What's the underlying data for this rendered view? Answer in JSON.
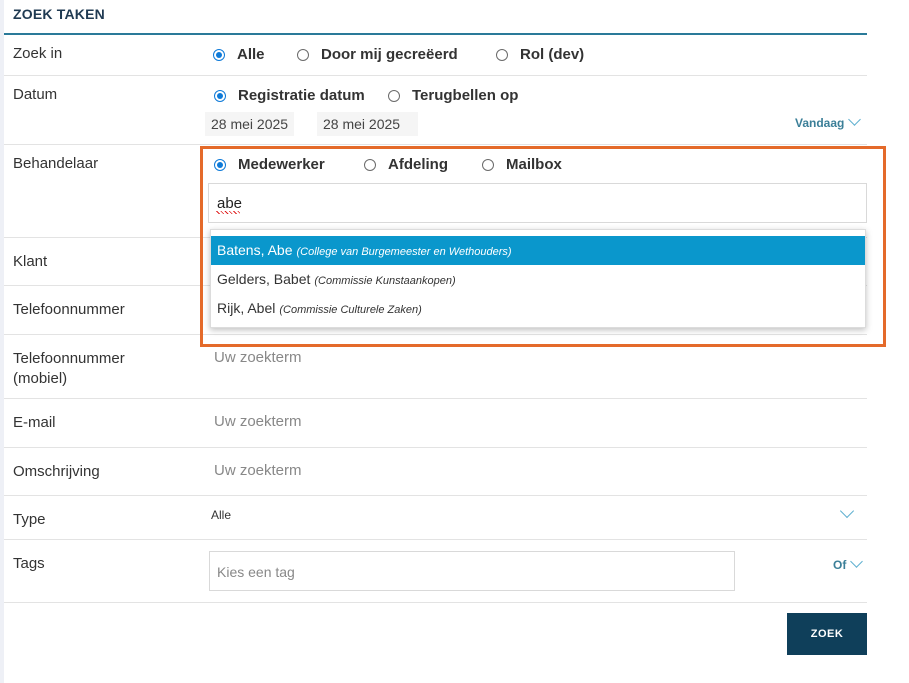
{
  "header": {
    "title": "ZOEK TAKEN"
  },
  "fields": {
    "zoek_in": {
      "label": "Zoek in",
      "options": [
        "Alle",
        "Door mij gecreëerd",
        "Rol (dev)"
      ],
      "selected": "Alle"
    },
    "datum": {
      "label": "Datum",
      "options": [
        "Registratie datum",
        "Terugbellen op"
      ],
      "selected": "Registratie datum",
      "from": "28 mei 2025",
      "to": "28 mei 2025",
      "preset": "Vandaag"
    },
    "behandelaar": {
      "label": "Behandelaar",
      "options": [
        "Medewerker",
        "Afdeling",
        "Mailbox"
      ],
      "selected": "Medewerker",
      "input_value": "abe",
      "suggestions": [
        {
          "name": "Batens, Abe",
          "org": "(College van Burgemeester en Wethouders)"
        },
        {
          "name": "Gelders, Babet",
          "org": "(Commissie Kunstaankopen)"
        },
        {
          "name": "Rijk, Abel",
          "org": "(Commissie Culturele Zaken)"
        }
      ]
    },
    "klant": {
      "label": "Klant"
    },
    "telefoonnummer": {
      "label": "Telefoonnummer"
    },
    "telefoonnummer_mobiel": {
      "label_line1": "Telefoonnummer",
      "label_line2": "(mobiel)",
      "placeholder": "Uw zoekterm"
    },
    "email": {
      "label": "E-mail",
      "placeholder": "Uw zoekterm"
    },
    "omschrijving": {
      "label": "Omschrijving",
      "placeholder": "Uw zoekterm"
    },
    "type": {
      "label": "Type",
      "value": "Alle"
    },
    "tags": {
      "label": "Tags",
      "placeholder": "Kies een tag",
      "operator": "Of"
    }
  },
  "actions": {
    "search_label": "ZOEK"
  },
  "colors": {
    "accent": "#0e7ad8",
    "highlight_border": "#e46a2a",
    "active_option": "#0a97cc",
    "button": "#0f3f5a"
  }
}
